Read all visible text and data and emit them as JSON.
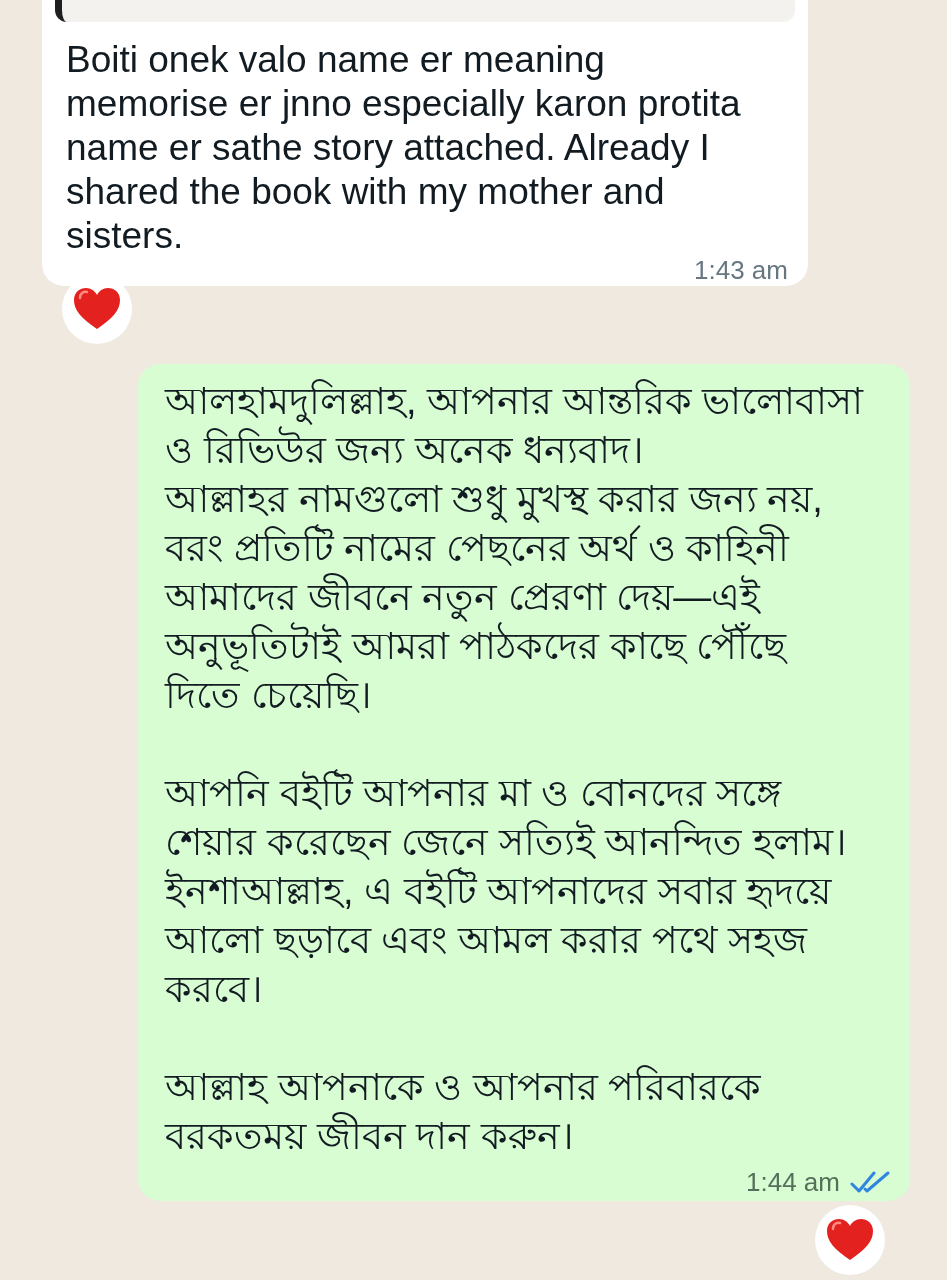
{
  "messages": [
    {
      "kind": "incoming",
      "quoted": true,
      "paragraphs": [
        "Boiti onek valo name er meaning\nmemorise er jnno especially karon protita\nname er sathe story attached. Already I\nshared the book with my mother and\nsisters."
      ],
      "time": "1:43 am",
      "reacted": true
    },
    {
      "kind": "outgoing",
      "paragraphs": [
        "আলহামদুলিল্লাহ, আপনার আন্তরিক ভালোবাসা\nও রিভিউর জন্য অনেক ধন্যবাদ।\nআল্লাহর নামগুলো শুধু মুখস্থ করার জন্য নয়,\nবরং প্রতিটি নামের পেছনের অর্থ ও কাহিনী\nআমাদের জীবনে নতুন প্রেরণা দেয়—এই\nঅনুভূতিটাই আমরা পাঠকদের কাছে পৌঁছে\nদিতে চেয়েছি।",
        "আপনি বইটি আপনার মা ও বোনদের সঙ্গে\nশেয়ার করেছেন জেনে সত্যিই আনন্দিত হলাম।\nইনশাআল্লাহ, এ বইটি আপনাদের সবার হৃদয়ে\nআলো ছড়াবে এবং আমল করার পথে সহজ\nকরবে।",
        "আল্লাহ আপনাকে ও আপনার পরিবারকে\nবরকতময় জীবন দান করুন।"
      ],
      "time": "1:44 am",
      "read": true,
      "reacted": true
    }
  ]
}
